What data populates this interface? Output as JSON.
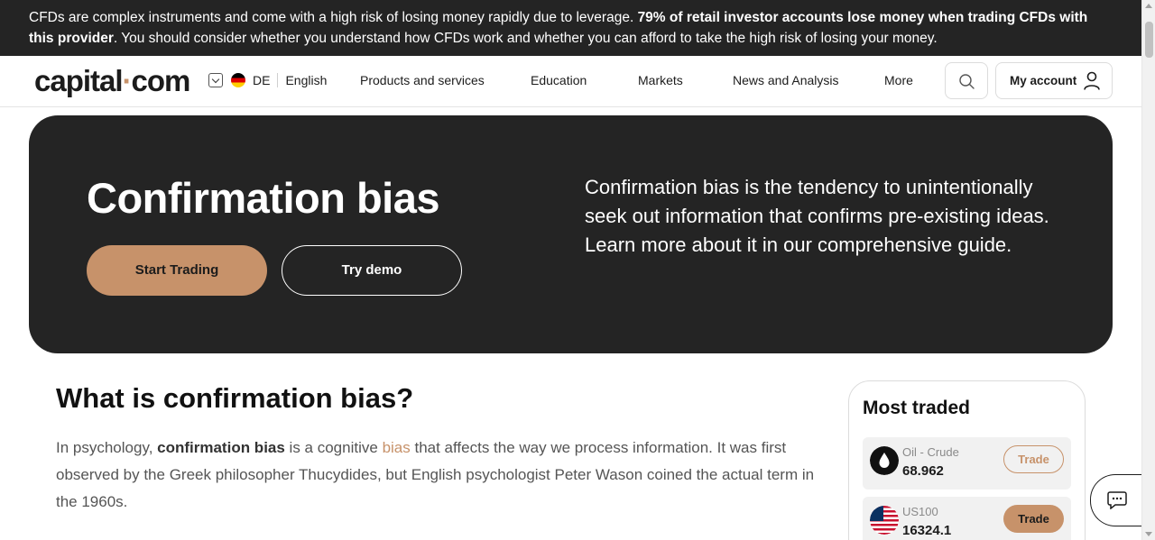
{
  "risk_banner": {
    "text_start": "CFDs are complex instruments and come with a high risk of losing money rapidly due to leverage. ",
    "text_bold": "79% of retail investor accounts lose money when trading CFDs with this provider",
    "text_end": ". You should consider whether you understand how CFDs work and whether you can afford to take the high risk of losing your money."
  },
  "header": {
    "logo_left": "capital",
    "logo_dot": "·",
    "logo_right": "com",
    "country_code": "DE",
    "language": "English",
    "nav": [
      "Products and services",
      "Education",
      "Markets",
      "News and Analysis",
      "More"
    ],
    "account_label": "My account"
  },
  "hero": {
    "title": "Confirmation bias",
    "start_label": "Start Trading",
    "demo_label": "Try demo",
    "description": "Confirmation bias is the tendency to unintentionally seek out information that confirms pre-existing ideas. Learn more about it in our comprehensive guide."
  },
  "article": {
    "heading": "What is confirmation bias?",
    "p1_a": "In psychology, ",
    "p1_bold": "confirmation bias",
    "p1_b": " is a cognitive ",
    "p1_link": "bias",
    "p1_c": " that affects the way we process information. It was first observed by the Greek philosopher Thucydides, but English psychologist Peter Wason coined the actual term in the 1960s."
  },
  "most_traded": {
    "title": "Most traded",
    "items": [
      {
        "name": "Oil - Crude",
        "price": "68.962",
        "trade_label": "Trade",
        "icon": "oil-drop-icon"
      },
      {
        "name": "US100",
        "price": "16324.1",
        "trade_label": "Trade",
        "icon": "us-flag-icon"
      }
    ]
  },
  "colors": {
    "accent": "#c7926a",
    "dark": "#242424"
  }
}
